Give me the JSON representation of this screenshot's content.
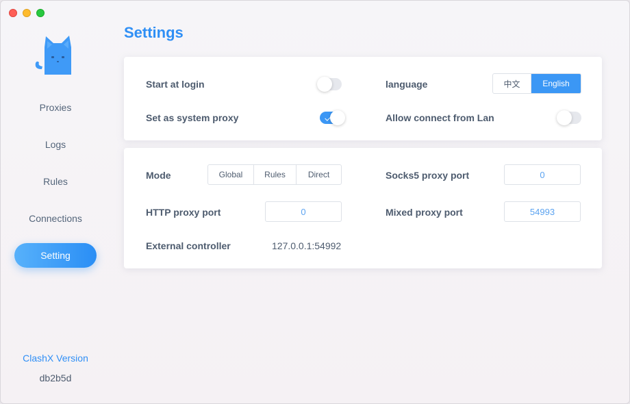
{
  "window": {
    "traffic_lights": [
      "close",
      "minimize",
      "maximize"
    ]
  },
  "colors": {
    "accent": "#2f8ff5",
    "logo": "#3f9af7",
    "text": "#4d5b6e",
    "input_text": "#5ba3f0"
  },
  "sidebar": {
    "logo_icon": "cat-logo-icon",
    "items": [
      {
        "label": "Proxies",
        "active": false
      },
      {
        "label": "Logs",
        "active": false
      },
      {
        "label": "Rules",
        "active": false
      },
      {
        "label": "Connections",
        "active": false
      },
      {
        "label": "Setting",
        "active": true
      }
    ],
    "version_label": "ClashX Version",
    "version_value": "db2b5d"
  },
  "page": {
    "title": "Settings"
  },
  "general": {
    "start_at_login": {
      "label": "Start at login",
      "enabled": false
    },
    "system_proxy": {
      "label": "Set as system proxy",
      "enabled": true
    },
    "language": {
      "label": "language",
      "options": [
        "中文",
        "English"
      ],
      "selected": "English"
    },
    "allow_lan": {
      "label": "Allow connect from Lan",
      "enabled": false
    }
  },
  "proxy": {
    "mode": {
      "label": "Mode",
      "options": [
        "Global",
        "Rules",
        "Direct"
      ],
      "selected": null
    },
    "http_port": {
      "label": "HTTP proxy port",
      "value": "0"
    },
    "socks5_port": {
      "label": "Socks5 proxy port",
      "value": "0"
    },
    "mixed_port": {
      "label": "Mixed proxy port",
      "value": "54993"
    },
    "external_controller": {
      "label": "External controller",
      "value": "127.0.0.1:54992"
    }
  }
}
